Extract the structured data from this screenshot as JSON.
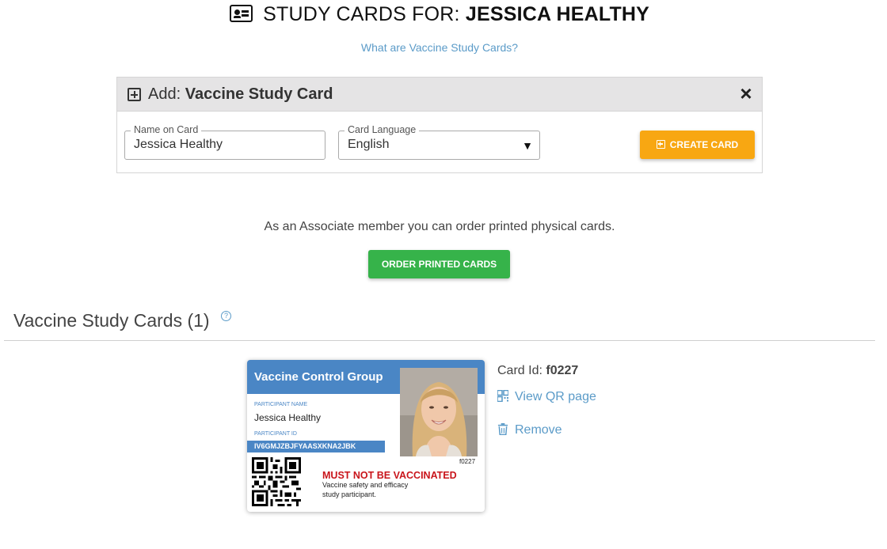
{
  "header": {
    "title_prefix": "STUDY CARDS FOR:",
    "title_name": "JESSICA HEALTHY",
    "help_link": "What are Vaccine Study Cards?"
  },
  "add_panel": {
    "title_prefix": "Add:",
    "title_main": "Vaccine Study Card",
    "name_field": {
      "label": "Name on Card",
      "value": "Jessica Healthy"
    },
    "language_field": {
      "label": "Card Language",
      "value": "English"
    },
    "create_button": "CREATE CARD"
  },
  "associate": {
    "text": "As an Associate member you can order printed physical cards.",
    "order_button": "ORDER PRINTED CARDS"
  },
  "cards_section": {
    "title": "Vaccine Study Cards (1)",
    "help_icon": "?"
  },
  "card": {
    "group": "Vaccine Control Group",
    "participant_name_label": "PARTICIPANT NAME",
    "participant_name": "Jessica Healthy",
    "participant_id_label": "PARTICIPANT ID",
    "participant_id": "IV6GMJZBJFYAASXKNA2JBK",
    "short_id": "f0227",
    "warning": "MUST NOT BE VACCINATED",
    "warning_line1": "Vaccine safety and efficacy",
    "warning_line2": "study participant."
  },
  "card_meta": {
    "card_id_label": "Card Id:",
    "card_id_value": "f0227",
    "view_qr": "View QR page",
    "remove": "Remove"
  },
  "colors": {
    "accent_blue": "#4a86c5",
    "link_blue": "#5b9bc8",
    "create_orange": "#f8a712",
    "order_green": "#36b34a",
    "warning_red": "#c9151b"
  },
  "icons": [
    "id-card-icon",
    "add-square-icon",
    "close-icon",
    "dropdown-caret-icon",
    "help-circle-icon",
    "qr-code-icon",
    "trash-icon"
  ]
}
